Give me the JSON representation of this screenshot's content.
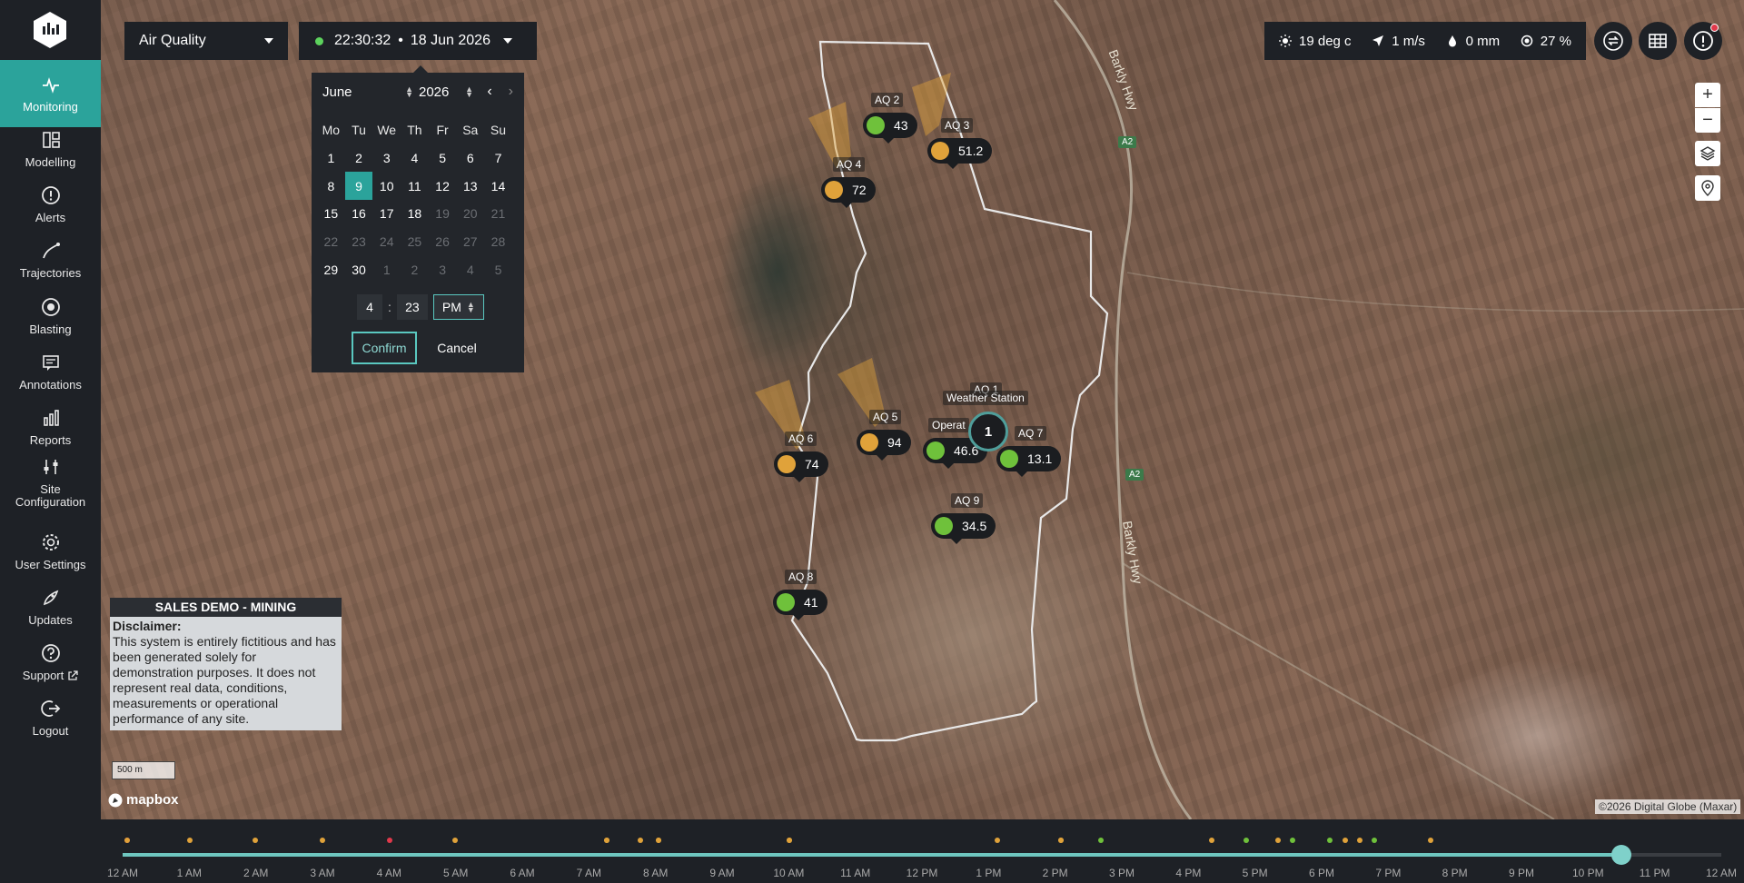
{
  "sidebar": {
    "items": [
      {
        "label": "Monitoring",
        "icon": "monitoring-icon",
        "active": true
      },
      {
        "label": "Modelling",
        "icon": "modelling-icon"
      },
      {
        "label": "Alerts",
        "icon": "alerts-icon"
      },
      {
        "label": "Trajectories",
        "icon": "trajectories-icon"
      },
      {
        "label": "Blasting",
        "icon": "blasting-icon"
      },
      {
        "label": "Annotations",
        "icon": "annotations-icon"
      },
      {
        "label": "Reports",
        "icon": "reports-icon"
      },
      {
        "label": "Site\nConfiguration",
        "icon": "site-configuration-icon"
      },
      {
        "label": "User Settings",
        "icon": "user-settings-icon"
      },
      {
        "label": "Updates",
        "icon": "updates-icon"
      },
      {
        "label": "Support",
        "icon": "support-icon"
      },
      {
        "label": "Logout",
        "icon": "logout-icon"
      }
    ]
  },
  "toolbar": {
    "layer": "Air Quality",
    "time": "22:30:32",
    "separator": "•",
    "date": "18 Jun 2026"
  },
  "weather": {
    "temperature": "19 deg c",
    "wind": "1 m/s",
    "rain": "0 mm",
    "humidity": "27 %"
  },
  "calendar": {
    "month": "June",
    "year": "2026",
    "weekdays": [
      "Mo",
      "Tu",
      "We",
      "Th",
      "Fr",
      "Sa",
      "Su"
    ],
    "days": [
      [
        "1",
        "2",
        "3",
        "4",
        "5",
        "6",
        "7"
      ],
      [
        "8",
        "9",
        "10",
        "11",
        "12",
        "13",
        "14"
      ],
      [
        "15",
        "16",
        "17",
        "18",
        "19",
        "20",
        "21"
      ],
      [
        "22",
        "23",
        "24",
        "25",
        "26",
        "27",
        "28"
      ],
      [
        "29",
        "30",
        "1",
        "2",
        "3",
        "4",
        "5"
      ]
    ],
    "selected_day": "9",
    "hour": "4",
    "colon": ":",
    "minute": "23",
    "ampm": "PM",
    "confirm_label": "Confirm",
    "cancel_label": "Cancel"
  },
  "markers": [
    {
      "label": "AQ 2",
      "value": "43",
      "color": "#6fc13b"
    },
    {
      "label": "AQ 3",
      "value": "51.2",
      "color": "#e0a23a"
    },
    {
      "label": "AQ 4",
      "value": "72",
      "color": "#e0a23a"
    },
    {
      "label": "AQ 5",
      "value": "94",
      "color": "#e0a23a"
    },
    {
      "label": "AQ 6",
      "value": "74",
      "color": "#e0a23a"
    },
    {
      "label": "Operat",
      "value": "46.6",
      "color": "#6fc13b"
    },
    {
      "label": "AQ 7",
      "value": "13.1",
      "color": "#6fc13b"
    },
    {
      "label": "AQ 9",
      "value": "34.5",
      "color": "#6fc13b"
    },
    {
      "label": "AQ 8",
      "value": "41",
      "color": "#6fc13b"
    }
  ],
  "map_labels": {
    "aq1": "AQ 1",
    "weather_station": "Weather Station",
    "cluster_count": "1",
    "road_a2": "A2",
    "highway": "Barkly Hwy"
  },
  "disclaimer": {
    "header": "SALES DEMO - MINING",
    "title": "Disclaimer:",
    "text": "This system is entirely fictitious and has been generated solely for demonstration purposes. It does not represent real data, conditions, measurements or operational performance of any site."
  },
  "scale_label": "500 m",
  "mapbox": "mapbox",
  "attribution": "©2026 Digital Globe (Maxar)",
  "timeline": {
    "ticks": [
      "12 AM",
      "1 AM",
      "2 AM",
      "3 AM",
      "4 AM",
      "5 AM",
      "6 AM",
      "7 AM",
      "8 AM",
      "9 AM",
      "10 AM",
      "11 AM",
      "12 PM",
      "1 PM",
      "2 PM",
      "3 PM",
      "4 PM",
      "5 PM",
      "6 PM",
      "7 PM",
      "8 PM",
      "9 PM",
      "10 PM",
      "11 PM",
      "12 AM"
    ],
    "current_label": "11 PM",
    "progress": 0.9375,
    "colors": {
      "red": "#e0394b",
      "orange": "#e0a23a",
      "green": "#6fc13b",
      "track_fill": "#6ec6bf"
    }
  }
}
